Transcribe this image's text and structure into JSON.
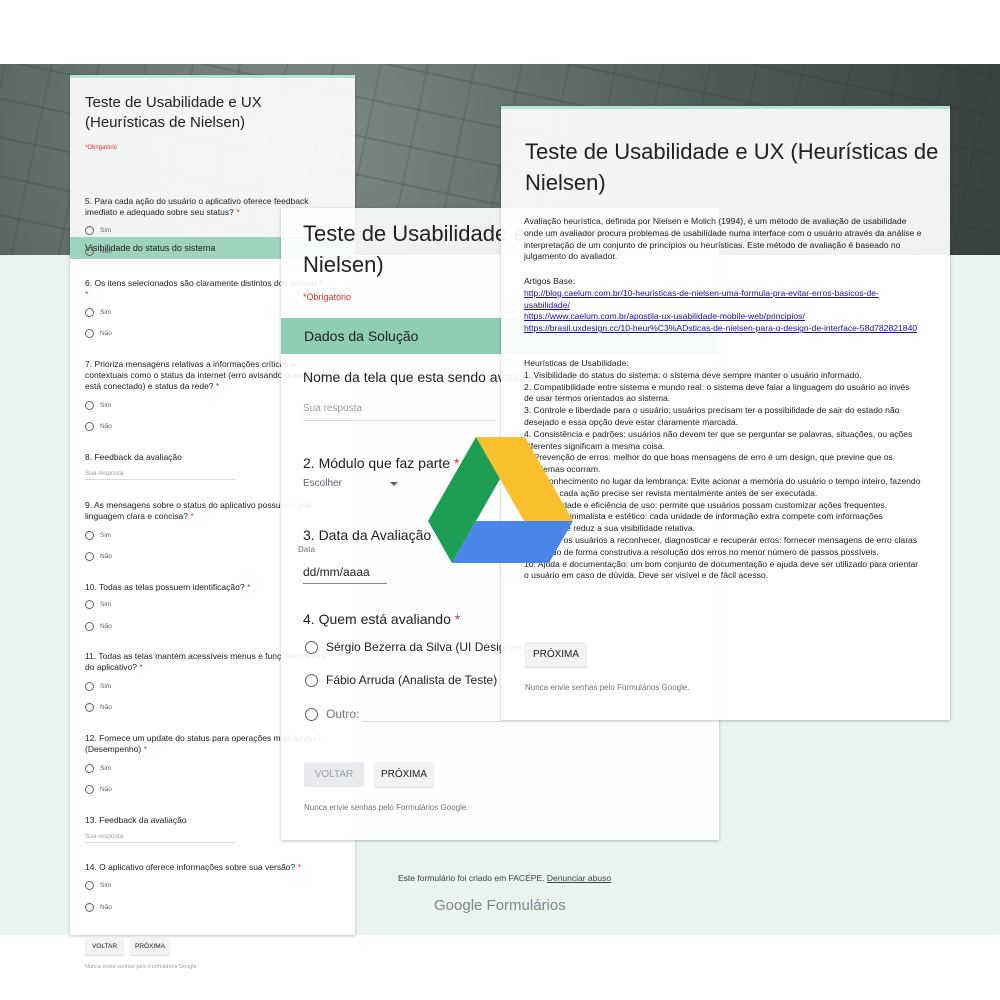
{
  "colors": {
    "mint": "#e9f4ef",
    "section": "#9ed3bd",
    "required": "#d93025",
    "link": "#1a0dab"
  },
  "left_form": {
    "title": "Teste de Usabilidade e UX (Heurísticas de Nielsen)",
    "required_note": "*Obrigatório",
    "section": "Visibilidade do status do sistema",
    "q5": "5. Para cada ação do usuário o aplicativo oferece feedback imediato e adequado sobre seu status?",
    "q6": "6. Os itens selecionados são claramente distintos dos demais?",
    "q7": "7. Prioriza mensagens relativas a informações críticas e contextuais como o status da internet (erro avisando quando não está conectado) e status da rede?",
    "q8": "8. Feedback da avaliação",
    "q9": "9. As mensagens sobre o status do aplicativo possuem uma linguagem clara e concisa?",
    "q10": "10. Todas as telas possuem identificação?",
    "q11": "11. Todas as telas mantém acessíveis menus e funções comuns do aplicativo?",
    "q12": "12. Fornece um update do status para operações mais lentas? (Desempenho)",
    "q13": "13. Feedback da avaliação",
    "q14": "14. O aplicativo oferece informações sobre sua versão?",
    "yes": "Sim",
    "no": "Não",
    "answer_placeholder": "Sua resposta",
    "back": "VOLTAR",
    "next": "PRÓXIMA",
    "footer": "Nunca envie senhas pelo Formulários Google."
  },
  "mid_form": {
    "title": "Teste de Usabilidade e UX (Heurísticas de Nielsen)",
    "required_note": "*Obrigatório",
    "section": "Dados da Solução",
    "q1": "Nome da tela que esta sendo avaliada",
    "answer_placeholder": "Sua resposta",
    "q2": "2. Módulo que faz parte",
    "select_value": "Escolher",
    "q3": "3. Data da Avaliação",
    "date_label": "Data",
    "date_value": "dd/mm/aaaa",
    "q4": "4. Quem está avaliando",
    "option1": "Sérgio Bezerra da Silva (UI Designer)",
    "option2": "Fábio Arruda (Analista de Teste)",
    "option_other": "Outro:",
    "back": "VOLTAR",
    "next": "PRÓXIMA",
    "footer": "Nunca envie senhas pelo Formulários Google."
  },
  "right_form": {
    "title": "Teste de Usabilidade e UX (Heurísticas de Nielsen)",
    "intro": "Avaliação heurística, definida por Nielsen e Molich (1994), é um método de avaliação de usabilidade onde um avaliador procura problemas de usabilidade numa interface com o usuário através da análise e interpretação de um conjunto de princípios ou heurísticas. Este método de avaliação é baseado no julgamento do avaliador.",
    "articles_label": "Artigos Base:",
    "link1": "http://blog.caelum.com.br/10-heuristicas-de-nielsen-uma-formula-pra-evitar-erros-basicos-de-usabilidade/",
    "link2": "https://www.caelum.com.br/apostila-ux-usabilidade-mobile-web/principios/",
    "link3": "https://brasil.uxdesign.cc/10-heur%C3%ADsticas-de-nielsen-para-o-design-de-interface-58d782821840",
    "heuristics_label": "Heurísticas de Usabilidade:",
    "h1": "1. Visibilidade do status do sistema: o sistema deve sempre manter o usuário informado.",
    "h2": "2. Compatibilidade entre sistema e mundo real: o sistema deve falar a linguagem do usuário ao invés",
    "h2b": "de usar termos orientados ao sistema.",
    "h3": "3. Controle e liberdade para o usuário: usuários precisam ter a possibilidade de sair do estado não desejado e essa opção deve estar claramente marcada.",
    "h4": "4. Consistência e padrões: usuários não devem ter que se perguntar se palavras, situações, ou ações diferentes significam a mesma coisa.",
    "h5": "5. Prevenção de erros: melhor do que boas mensagens de erro é um design, que previne que os problemas ocorram.",
    "h6": "6. Reconhecimento no lugar da lembrança: Evite acionar a memória do usuário o tempo inteiro, fazendo com que cada ação precise ser revista mentalmente antes de ser executada.",
    "h7": "7. Flexibilidade e eficiência de uso: permite que usuários possam customizar ações frequentes.",
    "h8": "8. Design minimalista e estético: cada unidade de informação extra compete com informações relevantes e reduz a sua visibilidade relativa.",
    "h9": "9. Auxiliar os usuários a reconhecer, diagnosticar e recuperar erros: fornecer mensagens de erro claras instruindo de forma construtiva a resolução dos erros no menor número de passos possíveis.",
    "h10": "10. Ajuda e documentação: um bom conjunto de documentação e ajuda deve ser utilizado para orientar o usuário em caso de dúvida. Deve ser visível e de fácil acesso.",
    "next": "PRÓXIMA",
    "footer": "Nunca envie senhas pelo Formulários Google."
  },
  "footer": {
    "credit": "Este formulário foi criado em FACEPE.",
    "report": "Denunciar abuso",
    "brand_google": "Google",
    "brand_forms": "Formulários"
  },
  "logo": {
    "icon": "google-drive-icon"
  }
}
